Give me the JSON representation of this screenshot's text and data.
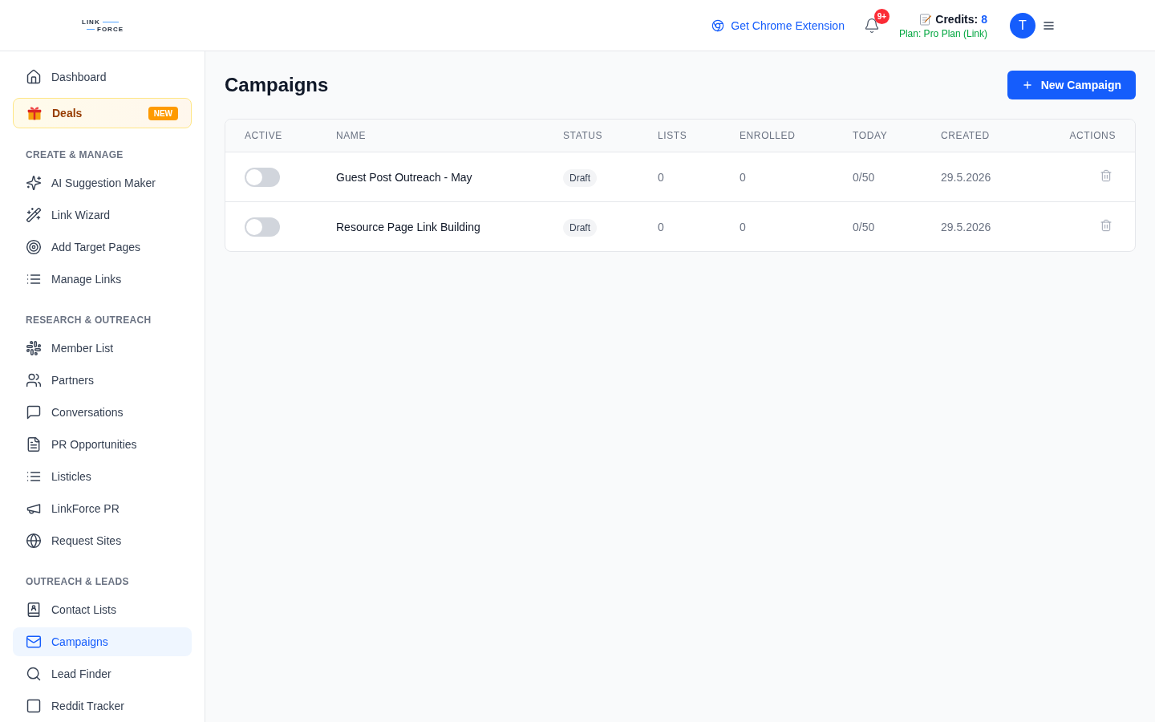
{
  "header": {
    "logo": [
      "LINK",
      "FORCE"
    ],
    "extension_link": "Get Chrome Extension",
    "notification_badge": "9+",
    "credits": {
      "label": "Credits:",
      "value": "8"
    },
    "plan": "Plan: Pro Plan (Link)",
    "avatar_initial": "T"
  },
  "sidebar": {
    "top_items": [
      {
        "kind": "link",
        "label": "Dashboard",
        "selected": false
      },
      {
        "kind": "promo",
        "label": "Deals",
        "badge": "NEW",
        "selected": false
      }
    ],
    "sections": [
      {
        "heading": "CREATE & MANAGE",
        "items": [
          {
            "kind": "link",
            "label": "AI Suggestion Maker",
            "selected": false
          },
          {
            "kind": "link",
            "label": "Link Wizard",
            "selected": false
          },
          {
            "kind": "link",
            "label": "Add Target Pages",
            "selected": false
          },
          {
            "kind": "link",
            "label": "Manage Links",
            "selected": false
          }
        ]
      },
      {
        "heading": "RESEARCH & OUTREACH",
        "items": [
          {
            "kind": "link",
            "label": "Member List",
            "selected": false
          },
          {
            "kind": "link",
            "label": "Partners",
            "selected": false
          },
          {
            "kind": "link",
            "label": "Conversations",
            "selected": false
          },
          {
            "kind": "link",
            "label": "PR Opportunities",
            "selected": false
          },
          {
            "kind": "link",
            "label": "Listicles",
            "selected": false
          },
          {
            "kind": "link",
            "label": "LinkForce PR",
            "selected": false
          },
          {
            "kind": "link",
            "label": "Request Sites",
            "selected": false
          }
        ]
      },
      {
        "heading": "OUTREACH & LEADS",
        "items": [
          {
            "kind": "link",
            "label": "Contact Lists",
            "selected": false
          },
          {
            "kind": "link",
            "label": "Campaigns",
            "selected": true
          },
          {
            "kind": "link",
            "label": "Lead Finder",
            "selected": false
          },
          {
            "kind": "link",
            "label": "Reddit Tracker",
            "selected": false
          }
        ]
      }
    ]
  },
  "main": {
    "title": "Campaigns",
    "new_button": "New Campaign",
    "table": {
      "columns": [
        "ACTIVE",
        "NAME",
        "STATUS",
        "LISTS",
        "ENROLLED",
        "TODAY",
        "CREATED",
        "ACTIONS"
      ],
      "rows": [
        {
          "active": false,
          "name": "Guest Post Outreach - May",
          "status": "Draft",
          "lists": "0",
          "enrolled": "0",
          "today": "0/50",
          "created": "29.5.2026"
        },
        {
          "active": false,
          "name": "Resource Page Link Building",
          "status": "Draft",
          "lists": "0",
          "enrolled": "0",
          "today": "0/50",
          "created": "29.5.2026"
        }
      ]
    }
  }
}
